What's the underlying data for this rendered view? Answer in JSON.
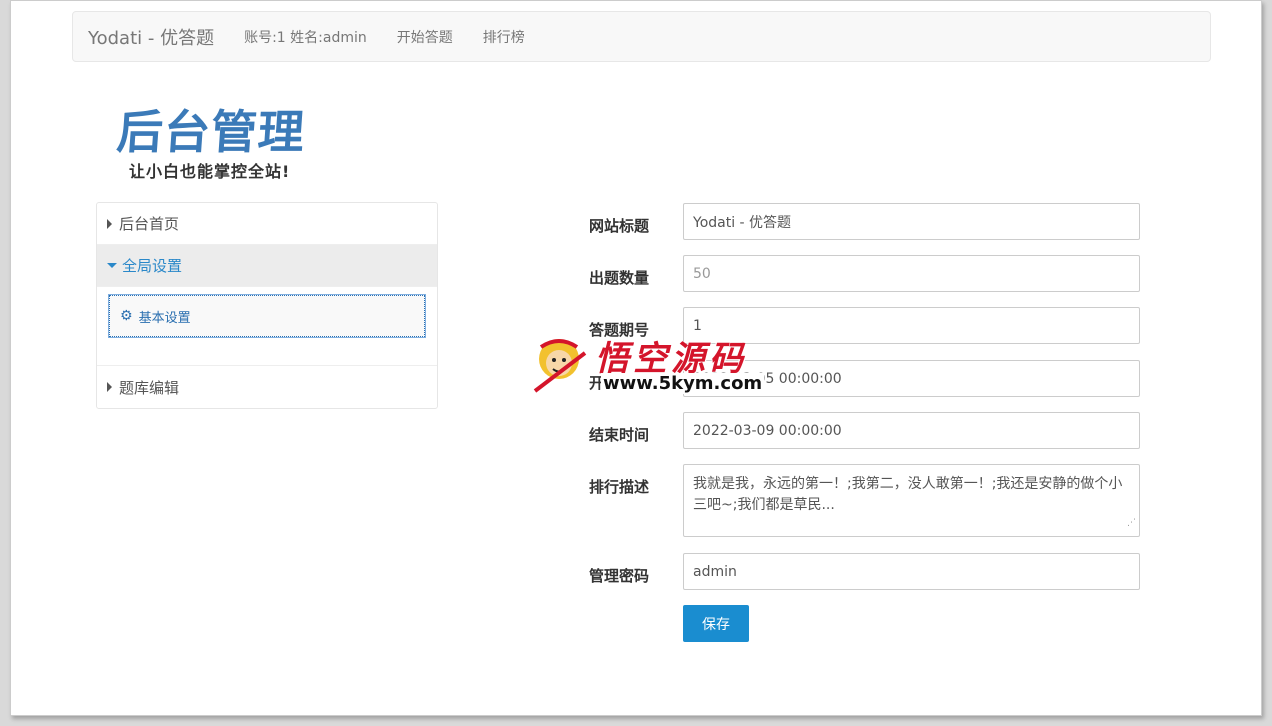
{
  "navbar": {
    "brand": "Yodati - 优答题",
    "account": "账号:1 姓名:admin",
    "start": "开始答题",
    "ranking": "排行榜"
  },
  "logo": {
    "title": "后台管理",
    "subtitle": "让小白也能掌控全站!"
  },
  "sidebar": {
    "home": "后台首页",
    "global": "全局设置",
    "basic": "基本设置",
    "bank": "题库编辑"
  },
  "form": {
    "site_title_label": "网站标题",
    "site_title_value": "Yodati - 优答题",
    "count_label": "出题数量",
    "count_placeholder": "50",
    "period_label": "答题期号",
    "period_value": "1",
    "start_label": "开始时间",
    "start_value": "2022-03-05 00:00:00",
    "end_label": "结束时间",
    "end_value": "2022-03-09 00:00:00",
    "desc_label": "排行描述",
    "desc_value": "我就是我，永远的第一！;我第二，没人敢第一！;我还是安静的做个小三吧~;我们都是草民...",
    "password_label": "管理密码",
    "password_value": "admin",
    "save": "保存"
  },
  "watermark": {
    "title": "悟空源码",
    "url": "www.5kym.com"
  },
  "colors": {
    "accent": "#1a8dd0",
    "logo": "#3b7ab8",
    "watermark": "#d4152b"
  }
}
